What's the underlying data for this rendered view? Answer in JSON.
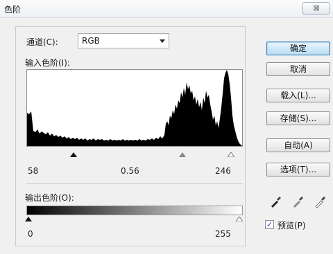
{
  "window": {
    "title": "色阶",
    "close_glyph": "⊠"
  },
  "channel": {
    "label": "通道(C):",
    "value": "RGB"
  },
  "input_levels": {
    "label": "输入色阶(I):",
    "black": "58",
    "gamma": "0.56",
    "white": "246"
  },
  "output_levels": {
    "label": "输出色阶(O):",
    "black": "0",
    "white": "255"
  },
  "buttons": {
    "ok": "确定",
    "cancel": "取消",
    "load": "载入(L)...",
    "save": "存储(S)...",
    "auto": "自动(A)",
    "options": "选项(T)..."
  },
  "preview": {
    "label": "预览(P)",
    "checked": true,
    "check_glyph": "✓"
  },
  "colors": {
    "histogram_fill": "#000000",
    "primary_button": "#b9dcf5"
  }
}
